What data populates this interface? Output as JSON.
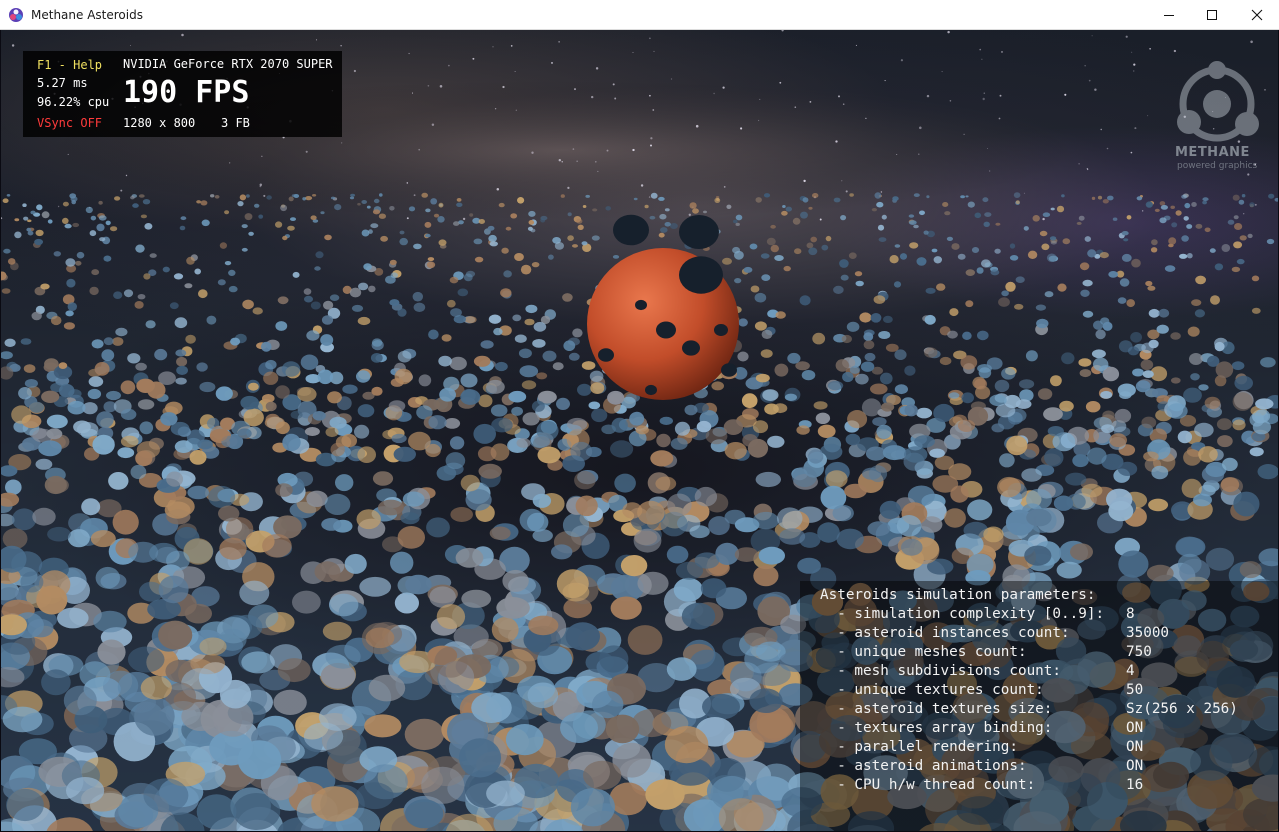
{
  "window": {
    "title": "Methane Asteroids",
    "minimize_icon": "minimize-icon",
    "maximize_icon": "maximize-icon",
    "close_icon": "close-icon"
  },
  "stats": {
    "help": "F1 - Help",
    "frame_time": "5.27 ms",
    "cpu_usage": "96.22% cpu",
    "vsync": "VSync OFF",
    "gpu_name": "NVIDIA GeForce RTX 2070 SUPER",
    "fps": "190 FPS",
    "resolution": "1280 x 800",
    "frame_buffers": "3 FB"
  },
  "logo": {
    "name": "METHANE",
    "tagline": "powered graphics"
  },
  "parameters": {
    "title": "Asteroids simulation parameters:",
    "items": [
      {
        "label": "  - simulation complexity [0..9]:",
        "value": "8"
      },
      {
        "label": "  - asteroid instances count:",
        "value": "35000"
      },
      {
        "label": "  - unique meshes count:",
        "value": "750"
      },
      {
        "label": "  - mesh subdivisions count:",
        "value": "4"
      },
      {
        "label": "  - unique textures count:",
        "value": "50"
      },
      {
        "label": "  - asteroid textures size:",
        "value": "Sz(256 x 256)"
      },
      {
        "label": "  - textures array binding:",
        "value": "ON"
      },
      {
        "label": "  - parallel rendering:",
        "value": "ON"
      },
      {
        "label": "  - asteroid animations:",
        "value": "ON"
      },
      {
        "label": "  - CPU h/w thread count:",
        "value": "16"
      }
    ]
  },
  "colors": {
    "help": "#f0e060",
    "vsync_off": "#ff3b3b",
    "planet": "#c9502e"
  }
}
